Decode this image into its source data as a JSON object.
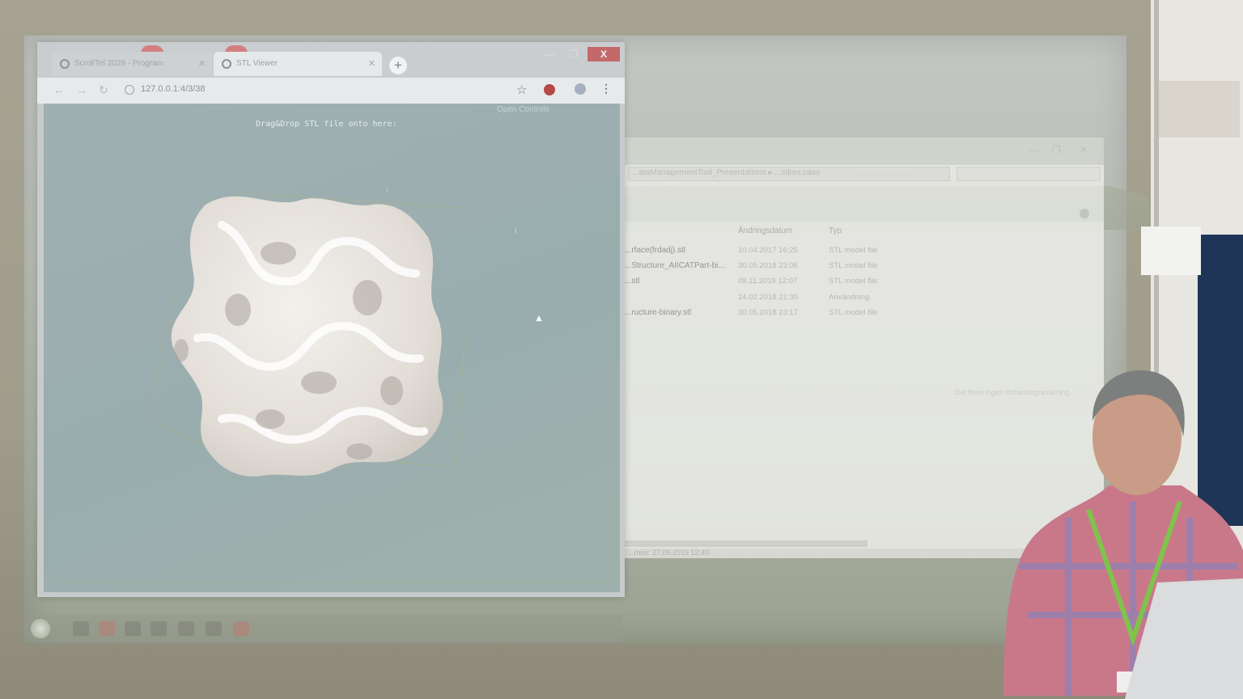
{
  "browser": {
    "tabs": [
      {
        "label": "ScrollTel 2029 - Program",
        "active": false
      },
      {
        "label": "STL Viewer",
        "active": true
      }
    ],
    "new_tab_label": "+",
    "window_controls": {
      "minimize": "—",
      "maximize": "❐",
      "close": "X"
    },
    "url": "127.0.0.1:4/3/38",
    "icons": [
      "back-icon",
      "forward-icon",
      "reload-icon",
      "info-icon",
      "star-icon",
      "extension-icon",
      "profile-icon",
      "menu-icon"
    ]
  },
  "viewer": {
    "open_controls": "Open Controls",
    "drop_hint": "Drag&Drop STL file onto here:",
    "axis_labels": [
      "↓",
      "i"
    ]
  },
  "explorer": {
    "address": "...ataManagementTool_Presentations ▸ ...stlres.caso",
    "columns": [
      "Ändringsdatum",
      "Typ"
    ],
    "files": [
      {
        "name": "...rface(frdadj).stl",
        "date": "10.04.2017 16:25",
        "type": "STL model file"
      },
      {
        "name": "...Structure_AIICATPart-bi...",
        "date": "30.05.2018 23:06",
        "type": "STL model file"
      },
      {
        "name": "...stl",
        "date": "09.11.2018 12:07",
        "type": "STL model file"
      },
      {
        "name": "",
        "date": "24.02.2018 21:30",
        "type": "Användning"
      },
      {
        "name": "...ructure-binary.stl",
        "date": "30.05.2018 23:17",
        "type": "STL model file"
      }
    ],
    "hint": "Det finns ingen förhandsgranskning",
    "status": "...rnes: 27.06.2019 12:40"
  },
  "colors": {
    "close_button": "#c3696a",
    "viewport": "#9fb0b2",
    "model": "#e8e4de"
  }
}
